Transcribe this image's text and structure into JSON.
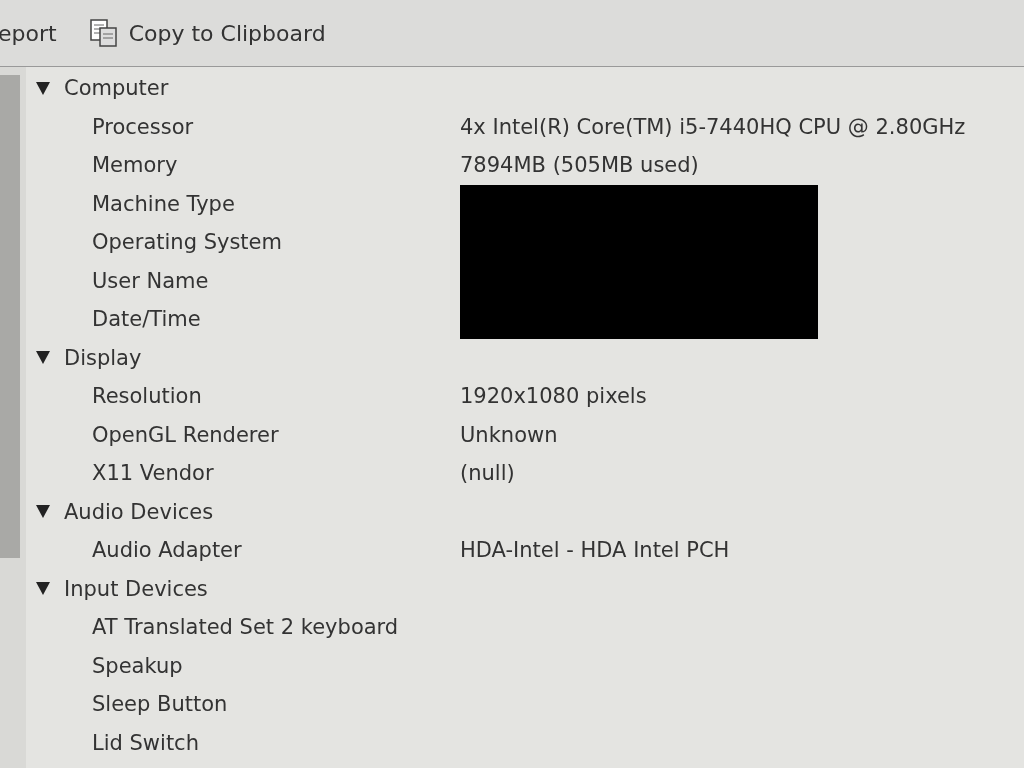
{
  "toolbar": {
    "items": [
      {
        "kind": "cut",
        "label": "eport"
      },
      {
        "kind": "copy",
        "label": "Copy to Clipboard"
      }
    ]
  },
  "tree": [
    {
      "name": "Computer",
      "expanded": true,
      "children": [
        {
          "label": "Processor",
          "value": "4x Intel(R) Core(TM) i5-7440HQ CPU @ 2.80GHz",
          "redacted": false
        },
        {
          "label": "Memory",
          "value": "7894MB (505MB used)",
          "redacted": false
        },
        {
          "label": "Machine Type",
          "redacted": true
        },
        {
          "label": "Operating System",
          "redacted": true
        },
        {
          "label": "User Name",
          "redacted": true
        },
        {
          "label": "Date/Time",
          "redacted": true
        }
      ]
    },
    {
      "name": "Display",
      "expanded": true,
      "children": [
        {
          "label": "Resolution",
          "value": "1920x1080 pixels",
          "redacted": false
        },
        {
          "label": "OpenGL Renderer",
          "value": "Unknown",
          "redacted": false
        },
        {
          "label": "X11 Vendor",
          "value": "(null)",
          "redacted": false
        }
      ]
    },
    {
      "name": "Audio Devices",
      "expanded": true,
      "children": [
        {
          "label": "Audio Adapter",
          "value": "HDA-Intel - HDA Intel PCH",
          "redacted": false
        }
      ]
    },
    {
      "name": "Input Devices",
      "expanded": true,
      "children": [
        {
          "label": "AT Translated Set 2 keyboard",
          "redacted": false
        },
        {
          "label": "Speakup",
          "redacted": false
        },
        {
          "label": "Sleep Button",
          "redacted": false
        },
        {
          "label": "Lid Switch",
          "redacted": false
        }
      ]
    }
  ]
}
